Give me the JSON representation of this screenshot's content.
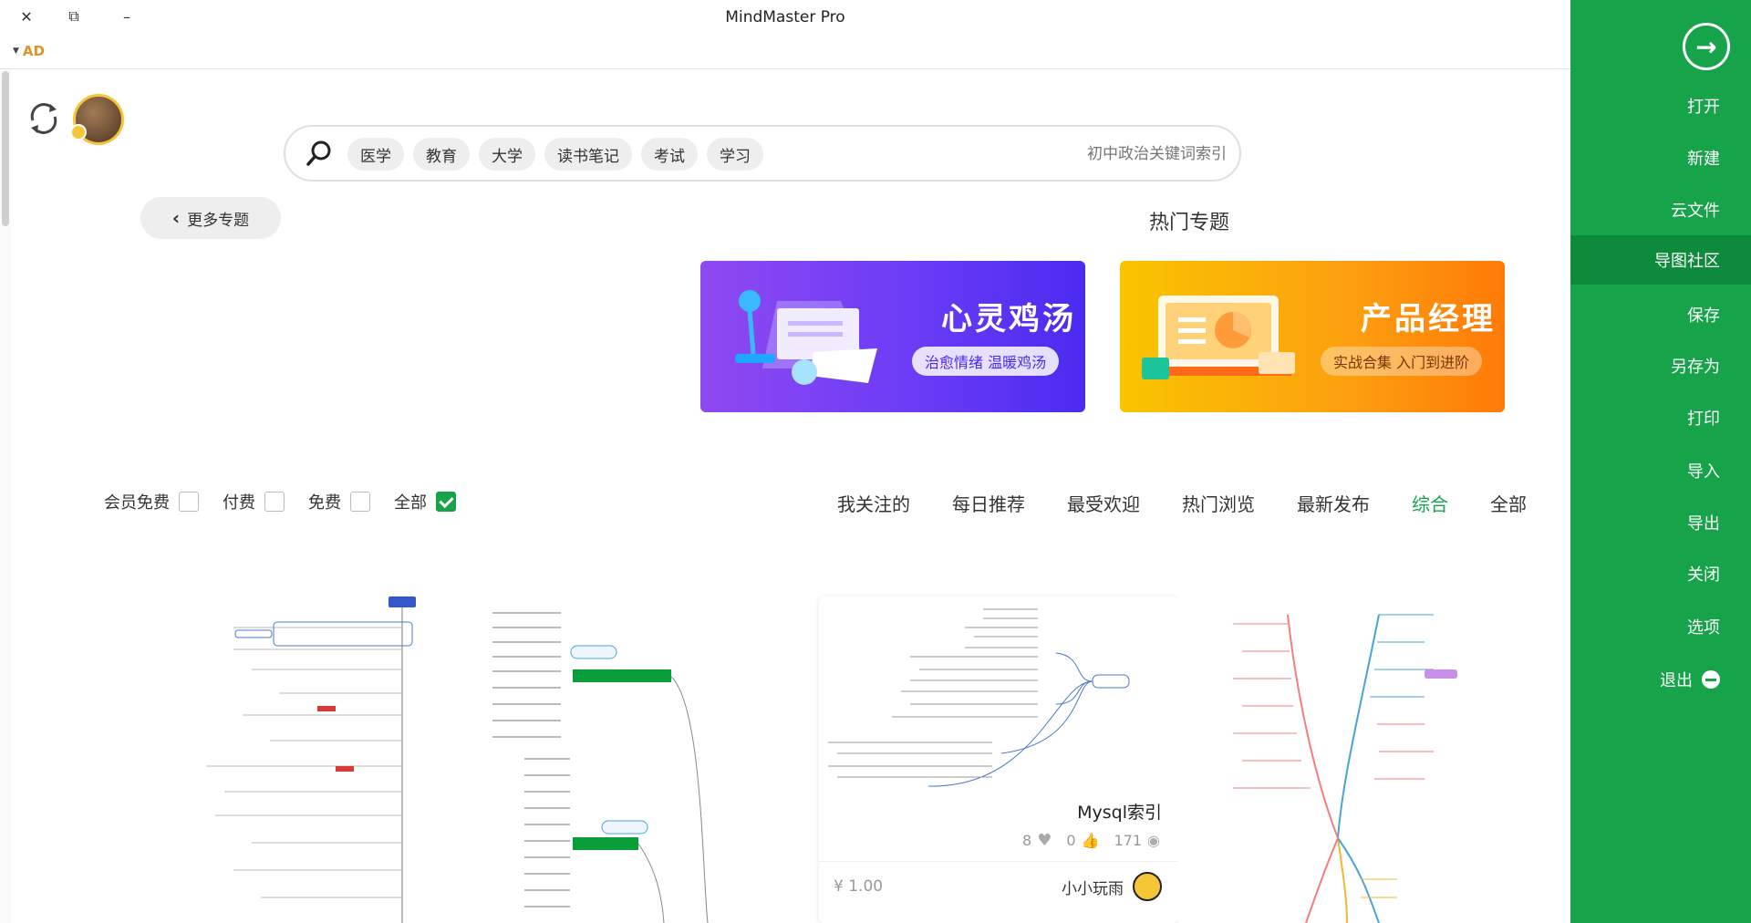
{
  "window": {
    "title": "MindMaster Pro",
    "ad_label": "AD"
  },
  "sidebar": {
    "items": [
      {
        "label": "打开"
      },
      {
        "label": "新建"
      },
      {
        "label": "云文件"
      },
      {
        "label": "导图社区",
        "active": true
      },
      {
        "label": "保存"
      },
      {
        "label": "另存为"
      },
      {
        "label": "打印"
      },
      {
        "label": "导入"
      },
      {
        "label": "导出"
      },
      {
        "label": "关闭"
      },
      {
        "label": "选项"
      },
      {
        "label": "退出"
      }
    ],
    "accent": "#17a34a"
  },
  "search": {
    "placeholder": "初中政治关键词索引",
    "tags": [
      "学习",
      "考试",
      "读书笔记",
      "大学",
      "教育",
      "医学"
    ]
  },
  "topics": {
    "title": "热门专题",
    "more_label": "更多专题",
    "banners": [
      {
        "title": "产品经理",
        "subtitle": "实战合集 入门到进阶"
      },
      {
        "title": "心灵鸡汤",
        "subtitle": "治愈情绪 温暖鸡汤"
      }
    ]
  },
  "filters": {
    "tabs": [
      "全部",
      "综合",
      "最新发布",
      "热门浏览",
      "最受欢迎",
      "每日推荐",
      "我关注的"
    ],
    "active_tab": "综合",
    "checks": [
      {
        "label": "全部",
        "checked": true
      },
      {
        "label": "免费",
        "checked": false
      },
      {
        "label": "付费",
        "checked": false
      },
      {
        "label": "会员免费",
        "checked": false
      }
    ]
  },
  "cards": [
    {
      "title": "Mysql索引",
      "views": "171",
      "likes": "0",
      "favorites": "8",
      "author": "小小玩雨",
      "price": "¥ 1.00"
    }
  ]
}
